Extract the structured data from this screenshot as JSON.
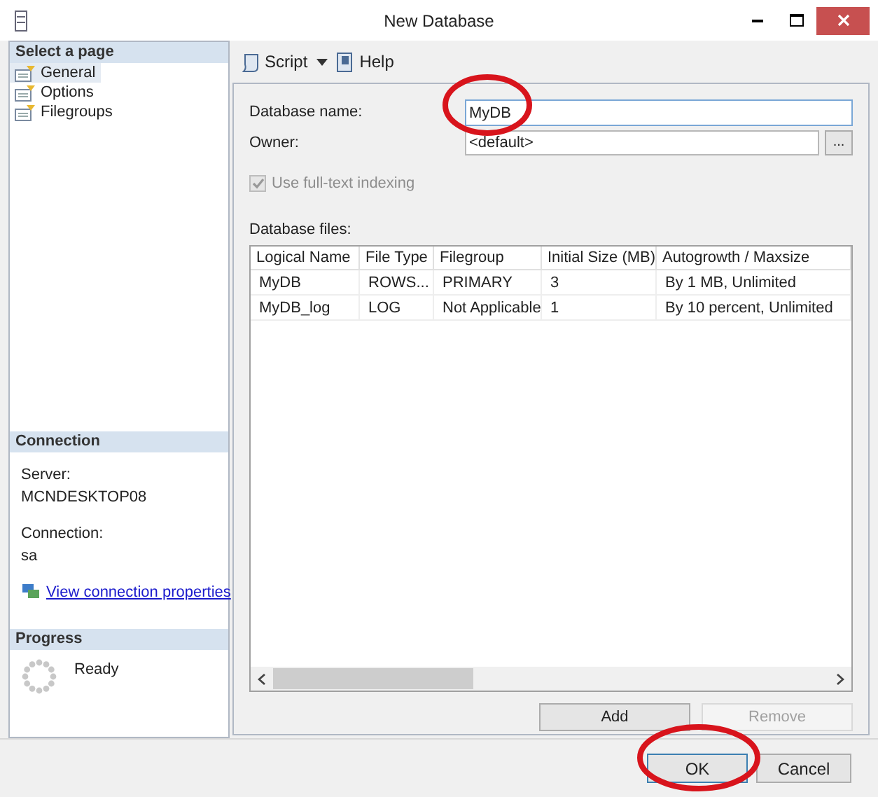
{
  "window": {
    "title": "New Database"
  },
  "sidebar": {
    "select_page": {
      "header": "Select a page",
      "items": [
        {
          "label": "General",
          "selected": true
        },
        {
          "label": "Options",
          "selected": false
        },
        {
          "label": "Filegroups",
          "selected": false
        }
      ]
    },
    "connection": {
      "header": "Connection",
      "server_label": "Server:",
      "server": "MCNDESKTOP08",
      "connection_label": "Connection:",
      "connection": "sa",
      "link": "View connection properties"
    },
    "progress": {
      "header": "Progress",
      "status": "Ready"
    }
  },
  "toolbar": {
    "script": "Script",
    "help": "Help"
  },
  "form": {
    "database_name": {
      "label": "Database name:",
      "value": "MyDB"
    },
    "owner": {
      "label": "Owner:",
      "value": "<default>",
      "browse": "..."
    },
    "fulltext": {
      "label": "Use full-text indexing",
      "checked": true,
      "disabled": true
    }
  },
  "files": {
    "label": "Database files:",
    "columns": [
      "Logical Name",
      "File Type",
      "Filegroup",
      "Initial Size (MB)",
      "Autogrowth / Maxsize"
    ],
    "rows": [
      {
        "cells": [
          "MyDB",
          "ROWS...",
          "PRIMARY",
          "3",
          "By 1 MB, Unlimited"
        ]
      },
      {
        "cells": [
          "MyDB_log",
          "LOG",
          "Not Applicable",
          "1",
          "By 10 percent, Unlimited"
        ]
      }
    ],
    "buttons": [
      {
        "label": "Add",
        "disabled": false
      },
      {
        "label": "Remove",
        "disabled": true
      }
    ]
  },
  "dialog_buttons": [
    {
      "label": "OK",
      "default": true
    },
    {
      "label": "Cancel",
      "default": false
    }
  ]
}
